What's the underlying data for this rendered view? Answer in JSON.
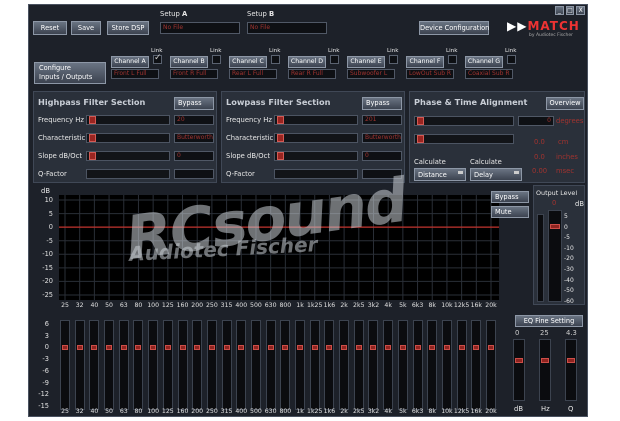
{
  "toolbar": {
    "reset": "Reset",
    "save": "Save",
    "store_dsp": "Store DSP"
  },
  "setup_a": {
    "label_prefix": "Setup",
    "label_letter": "A",
    "value": "No File"
  },
  "setup_b": {
    "label_prefix": "Setup",
    "label_letter": "B",
    "value": "No File"
  },
  "device_config": "Device Configuration",
  "window_controls": {
    "minimize": "_",
    "maximize": "□",
    "close": "X"
  },
  "logo": {
    "arrows": "▶▶",
    "text": "MATCH",
    "sub": "by Audiotec Fischer"
  },
  "configure": {
    "line1": "Configure",
    "line2": "Inputs / Outputs"
  },
  "link_label": "Link",
  "channels": [
    {
      "name": "Channel A",
      "value": "Front L Full",
      "linked": true
    },
    {
      "name": "Channel B",
      "value": "Front R Full",
      "linked": false
    },
    {
      "name": "Channel C",
      "value": "Rear L Full",
      "linked": false
    },
    {
      "name": "Channel D",
      "value": "Rear R Full",
      "linked": false
    },
    {
      "name": "Channel E",
      "value": "Subwoofer L",
      "linked": false
    },
    {
      "name": "Channel F",
      "value": "LowOut Sub R",
      "linked": false
    },
    {
      "name": "Channel G",
      "value": "Coaxial Sub R",
      "linked": false
    }
  ],
  "highpass": {
    "title": "Highpass Filter Section",
    "bypass": "Bypass",
    "freq_label": "Frequency Hz",
    "freq": "20",
    "char_label": "Characteristic",
    "char": "Butterworth",
    "slope_label": "Slope dB/Oct",
    "slope": "0",
    "q_label": "Q-Factor",
    "q": ""
  },
  "lowpass": {
    "title": "Lowpass Filter Section",
    "bypass": "Bypass",
    "freq_label": "Frequency Hz",
    "freq": "201",
    "char_label": "Characteristic",
    "char": "Butterworth",
    "slope_label": "Slope dB/Oct",
    "slope": "0",
    "q_label": "Q-Factor",
    "q": ""
  },
  "phase": {
    "title": "Phase & Time Alignment",
    "overview": "Overview",
    "degrees_val": "0",
    "degrees_unit": "degrees",
    "cm_val": "0.0",
    "cm_unit": "cm",
    "inches_val": "0.0",
    "inches_unit": "inches",
    "msec_val": "0.00",
    "msec_unit": "msec",
    "calc1_label": "Calculate",
    "calc1_value": "Distance",
    "calc2_label": "Calculate",
    "calc2_value": "Delay"
  },
  "eq_graph": {
    "db_label": "dB",
    "y_ticks": [
      "10",
      "5",
      "0",
      "-5",
      "-10",
      "-15",
      "-20",
      "-25"
    ],
    "bypass": "Bypass",
    "mute": "Mute"
  },
  "frequencies": [
    "25",
    "32",
    "40",
    "50",
    "63",
    "80",
    "100",
    "125",
    "160",
    "200",
    "250",
    "315",
    "400",
    "500",
    "630",
    "800",
    "1k",
    "1k25",
    "1k6",
    "2k",
    "2k5",
    "3k2",
    "4k",
    "5k",
    "6k3",
    "8k",
    "10k",
    "12k5",
    "16k",
    "20k"
  ],
  "output_level": {
    "title": "Output Level",
    "top_value": "0",
    "db_label": "dB",
    "ticks": [
      "5",
      "0",
      "-5",
      "-10",
      "-20",
      "-30",
      "-40",
      "-50",
      "-60"
    ],
    "level_db": 0
  },
  "eq_sliders": {
    "y_ticks": [
      "6",
      "3",
      "0",
      "-3",
      "-6",
      "-9",
      "-12",
      "-15"
    ],
    "gains_db": [
      0,
      0,
      0,
      0,
      0,
      0,
      0,
      0,
      0,
      0,
      0,
      0,
      0,
      0,
      0,
      0,
      0,
      0,
      0,
      0,
      0,
      0,
      0,
      0,
      0,
      0,
      0,
      0,
      0,
      0
    ]
  },
  "fine": {
    "title": "EQ Fine Setting",
    "db_val": "0",
    "hz_val": "25",
    "q_val": "4.3",
    "db": "dB",
    "hz": "Hz",
    "q": "Q"
  },
  "watermark": {
    "big": "RCsound",
    "small": "Audiotec Fischer"
  },
  "colors": {
    "accent": "#c0322c",
    "panel": "#2a303a",
    "graph_line": "#c0322c"
  }
}
